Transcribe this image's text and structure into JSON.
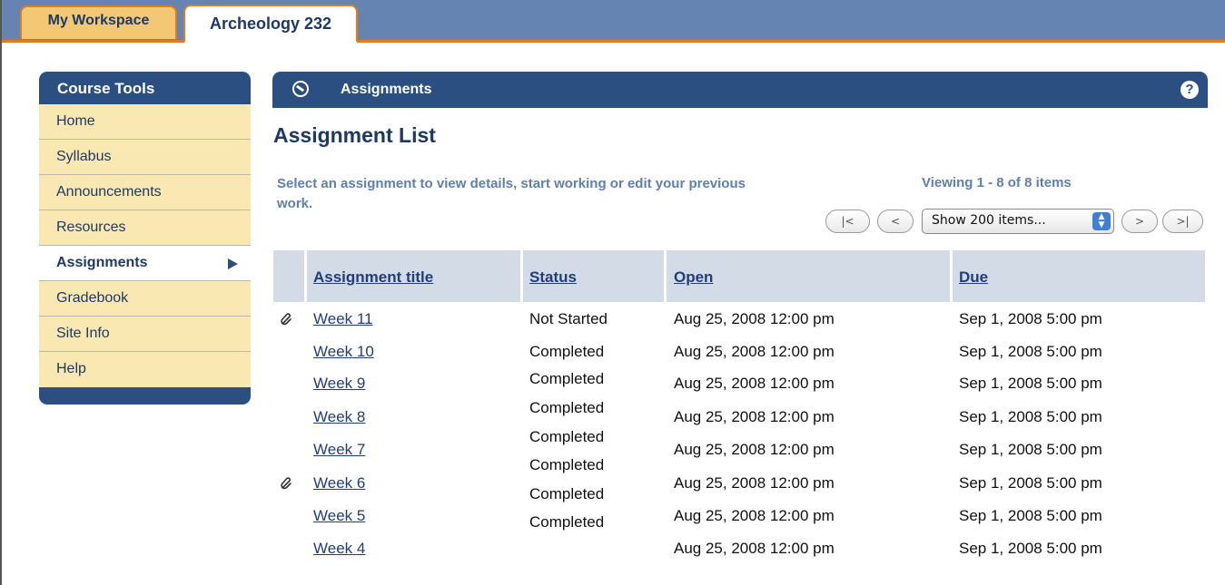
{
  "tabs": {
    "workspace": "My Workspace",
    "course": "Archeology 232"
  },
  "sidebar": {
    "header": "Course Tools",
    "items": [
      {
        "label": "Home"
      },
      {
        "label": "Syllabus"
      },
      {
        "label": "Announcements"
      },
      {
        "label": "Resources"
      },
      {
        "label": "Assignments",
        "active": true
      },
      {
        "label": "Gradebook"
      },
      {
        "label": "Site Info"
      },
      {
        "label": "Help"
      }
    ]
  },
  "tool": {
    "title": "Assignments",
    "icon": "assignments-icon",
    "help_label": "?"
  },
  "main": {
    "page_title": "Assignment List",
    "instructions": "Select an assignment to view details, start working or edit your previous work.",
    "viewing": "Viewing 1 - 8 of 8 items",
    "pager": {
      "first": "|<",
      "prev": "<",
      "select": "Show 200 items...",
      "next": ">",
      "last": ">|"
    },
    "columns": {
      "title": "Assignment title",
      "status": "Status",
      "open": "Open",
      "due": "Due"
    },
    "rows": [
      {
        "title": "Week 11",
        "status": "Not Started",
        "open": "Aug 25, 2008 12:00 pm",
        "due": "Sep 1, 2008 5:00 pm",
        "attachment": true
      },
      {
        "title": "Week 10",
        "status": "Completed",
        "open": "Aug 25, 2008 12:00 pm",
        "due": "Sep 1, 2008 5:00 pm",
        "attachment": false
      },
      {
        "title": "Week 9",
        "status": "Completed",
        "open": "Aug 25, 2008 12:00 pm",
        "due": "Sep 1, 2008 5:00 pm",
        "attachment": false
      },
      {
        "title": "Week 8",
        "status": "Completed",
        "open": "Aug 25, 2008 12:00 pm",
        "due": "Sep 1, 2008 5:00 pm",
        "attachment": false
      },
      {
        "title": "Week 7",
        "status": "Completed",
        "open": "Aug 25, 2008 12:00 pm",
        "due": "Sep 1, 2008 5:00 pm",
        "attachment": false
      },
      {
        "title": "Week 6",
        "status": "Completed",
        "open": "Aug 25, 2008 12:00 pm",
        "due": "Sep 1, 2008 5:00 pm",
        "attachment": true
      },
      {
        "title": "Week 5",
        "status": "Completed",
        "open": "Aug 25, 2008 12:00 pm",
        "due": "Sep 1, 2008 5:00 pm",
        "attachment": false
      },
      {
        "title": "Week 4",
        "status": "Completed",
        "open": "Aug 25, 2008 12:00 pm",
        "due": "Sep 1, 2008 5:00 pm",
        "attachment": false
      }
    ]
  },
  "colors": {
    "nav_blue": "#2a4f80",
    "tab_bar": "#6584b1",
    "accent_orange": "#e07c1f",
    "sidebar_bg": "#fae8b2",
    "link": "#213d7a"
  }
}
